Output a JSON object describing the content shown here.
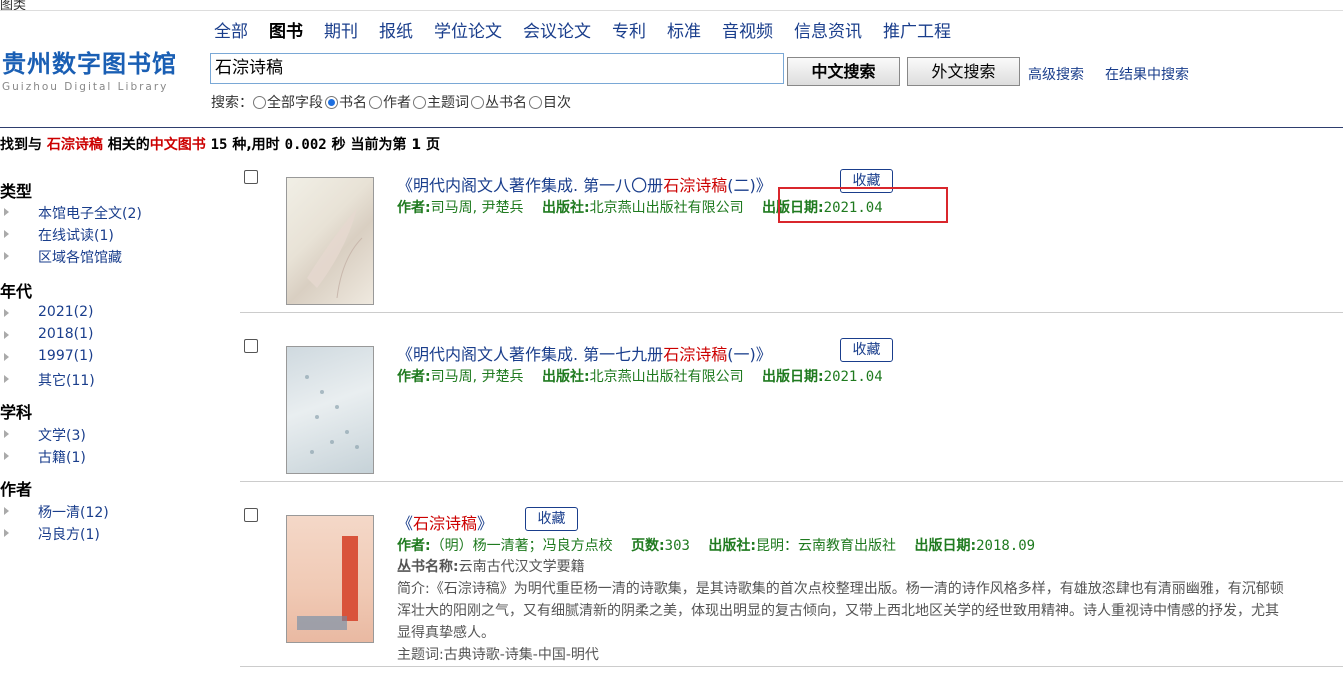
{
  "top_stub": "图类",
  "logo": {
    "cn": "贵州数字图书馆",
    "en": "Guizhou Digital Library"
  },
  "nav_tabs": [
    "全部",
    "图书",
    "期刊",
    "报纸",
    "学位论文",
    "会议论文",
    "专利",
    "标准",
    "音视频",
    "信息资讯",
    "推广工程"
  ],
  "active_tab": "图书",
  "search": {
    "value": "石淙诗稿",
    "btn_cn": "中文搜索",
    "btn_en": "外文搜索",
    "advanced": "高级搜索",
    "within": "在结果中搜索"
  },
  "search_field": {
    "label": "搜索：",
    "options": [
      "全部字段",
      "书名",
      "作者",
      "主题词",
      "丛书名",
      "目次"
    ],
    "selected": "书名"
  },
  "summary": {
    "p1": "找到与 ",
    "query": "石淙诗稿",
    "p2": " 相关的",
    "type": "中文图书",
    "p3": " ",
    "count": "15",
    "p4": " 种,用时 ",
    "time": "0.002",
    "p5": " 秒 当前为第 ",
    "page": "1",
    "p6": " 页"
  },
  "facets": {
    "type": {
      "title": "类型",
      "items": [
        "本馆电子全文(2)",
        "在线试读(1)",
        "区域各馆馆藏"
      ]
    },
    "year": {
      "title": "年代",
      "items": [
        "2021(2)",
        "2018(1)",
        "1997(1)",
        "其它(11)"
      ]
    },
    "subject": {
      "title": "学科",
      "items": [
        "文学(3)",
        "古籍(1)"
      ]
    },
    "author": {
      "title": "作者",
      "items": [
        "杨一清(12)",
        "冯良方(1)"
      ]
    }
  },
  "results": [
    {
      "title_pre": "《明代内阁文人著作集成. 第一八〇册",
      "title_hl": "石淙诗稿",
      "title_post": "(二)》",
      "fav": "收藏",
      "author_k": "作者:",
      "author_v": "司马周, 尹楚兵",
      "pub_k": "出版社:",
      "pub_v": "北京燕山出版社有限公司",
      "date_k": "出版日期:",
      "date_v": "2021.04"
    },
    {
      "title_pre": "《明代内阁文人著作集成. 第一七九册",
      "title_hl": "石淙诗稿",
      "title_post": "(一)》",
      "fav": "收藏",
      "author_k": "作者:",
      "author_v": "司马周, 尹楚兵",
      "pub_k": "出版社:",
      "pub_v": "北京燕山出版社有限公司",
      "date_k": "出版日期:",
      "date_v": "2021.04"
    },
    {
      "title_pre": "《",
      "title_hl": "石淙诗稿",
      "title_post": "》",
      "fav": "收藏",
      "author_k": "作者:",
      "author_v": "（明）杨一清著；冯良方点校",
      "pages_k": "页数:",
      "pages_v": "303",
      "pub_k": "出版社:",
      "pub_v": "昆明：云南教育出版社",
      "date_k": "出版日期:",
      "date_v": "2018.09",
      "series_k": "丛书名称:",
      "series_v": "云南古代汉文学要籍",
      "abstract": [
        "简介:《石淙诗稿》为明代重臣杨一清的诗歌集，是其诗歌集的首次点校整理出版。杨一清的诗作风格多样，有雄放恣肆也有清丽幽雅，有沉郁顿",
        "浑壮大的阳刚之气，又有细腻清新的阴柔之美，体现出明显的复古倾向，又带上西北地区关学的经世致用精神。诗人重视诗中情感的抒发，尤其",
        "显得真挚感人。"
      ],
      "subject": "主题词:古典诗歌-诗集-中国-明代"
    }
  ]
}
